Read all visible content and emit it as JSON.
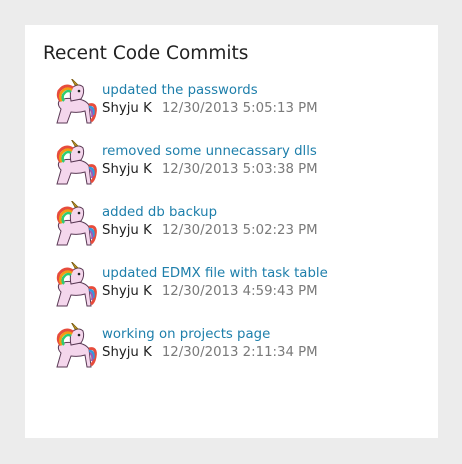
{
  "panel": {
    "title": "Recent Code Commits"
  },
  "commits": [
    {
      "message": "updated the passwords",
      "author": "Shyju K",
      "timestamp": "12/30/2013 5:05:13 PM",
      "avatar_icon": "unicorn-avatar-icon"
    },
    {
      "message": "removed some unnecassary dlls",
      "author": "Shyju K",
      "timestamp": "12/30/2013 5:03:38 PM",
      "avatar_icon": "unicorn-avatar-icon"
    },
    {
      "message": "added db backup",
      "author": "Shyju K",
      "timestamp": "12/30/2013 5:02:23 PM",
      "avatar_icon": "unicorn-avatar-icon"
    },
    {
      "message": "updated EDMX file with task table",
      "author": "Shyju K",
      "timestamp": "12/30/2013 4:59:43 PM",
      "avatar_icon": "unicorn-avatar-icon"
    },
    {
      "message": "working on projects page",
      "author": "Shyju K",
      "timestamp": "12/30/2013 2:11:34 PM",
      "avatar_icon": "unicorn-avatar-icon"
    }
  ],
  "colors": {
    "background": "#ececec",
    "card": "#ffffff",
    "link": "#1e7fab",
    "author": "#222222",
    "timestamp": "#7a7a7a"
  }
}
